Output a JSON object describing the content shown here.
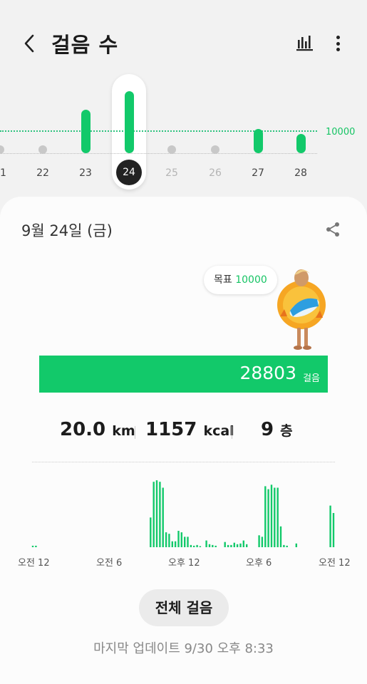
{
  "header": {
    "title": "걸음 수"
  },
  "week": {
    "goal_label": "10000",
    "days": [
      {
        "label": "21",
        "steps": 0,
        "state": "past"
      },
      {
        "label": "22",
        "steps": 0,
        "state": "past"
      },
      {
        "label": "23",
        "steps": 19000,
        "state": "past"
      },
      {
        "label": "24",
        "steps": 28803,
        "state": "selected"
      },
      {
        "label": "25",
        "steps": 0,
        "state": "future"
      },
      {
        "label": "26",
        "steps": 0,
        "state": "future"
      },
      {
        "label": "27",
        "steps": 10500,
        "state": "past"
      },
      {
        "label": "28",
        "steps": 8500,
        "state": "past"
      }
    ]
  },
  "detail": {
    "date": "9월 24일 (금)",
    "goal_text": "목표",
    "goal_value": "10000",
    "steps_value": "28803",
    "steps_unit": "걸음",
    "distance": "20.0",
    "distance_unit": "km",
    "calories": "1157",
    "calories_unit": "kcal",
    "floors": "9",
    "floors_unit": "층"
  },
  "hourly": {
    "x_labels": [
      "오전 12",
      "오전 6",
      "오후 12",
      "오후 6",
      "오전 12"
    ],
    "values": [
      2,
      2,
      0,
      0,
      0,
      0,
      0,
      0,
      0,
      0,
      0,
      0,
      0,
      0,
      0,
      0,
      0,
      0,
      0,
      0,
      0,
      0,
      0,
      0,
      0,
      0,
      0,
      0,
      0,
      0,
      0,
      0,
      0,
      0,
      0,
      0,
      0,
      0,
      40,
      88,
      90,
      88,
      80,
      20,
      18,
      8,
      8,
      22,
      20,
      14,
      14,
      3,
      2,
      3,
      1,
      0,
      9,
      4,
      3,
      2,
      0,
      0,
      7,
      3,
      3,
      6,
      4,
      5,
      9,
      4,
      0,
      0,
      0,
      16,
      14,
      82,
      78,
      84,
      80,
      80,
      28,
      3,
      2,
      0,
      0,
      5,
      0,
      0,
      0,
      0,
      0,
      0,
      0,
      0,
      0,
      0,
      56,
      46
    ]
  },
  "footer": {
    "total_button": "전체 걸음",
    "last_update": "마지막 업데이트 9/30 오후 8:33"
  },
  "colors": {
    "accent": "#12c96a",
    "goal": "#16c464"
  }
}
